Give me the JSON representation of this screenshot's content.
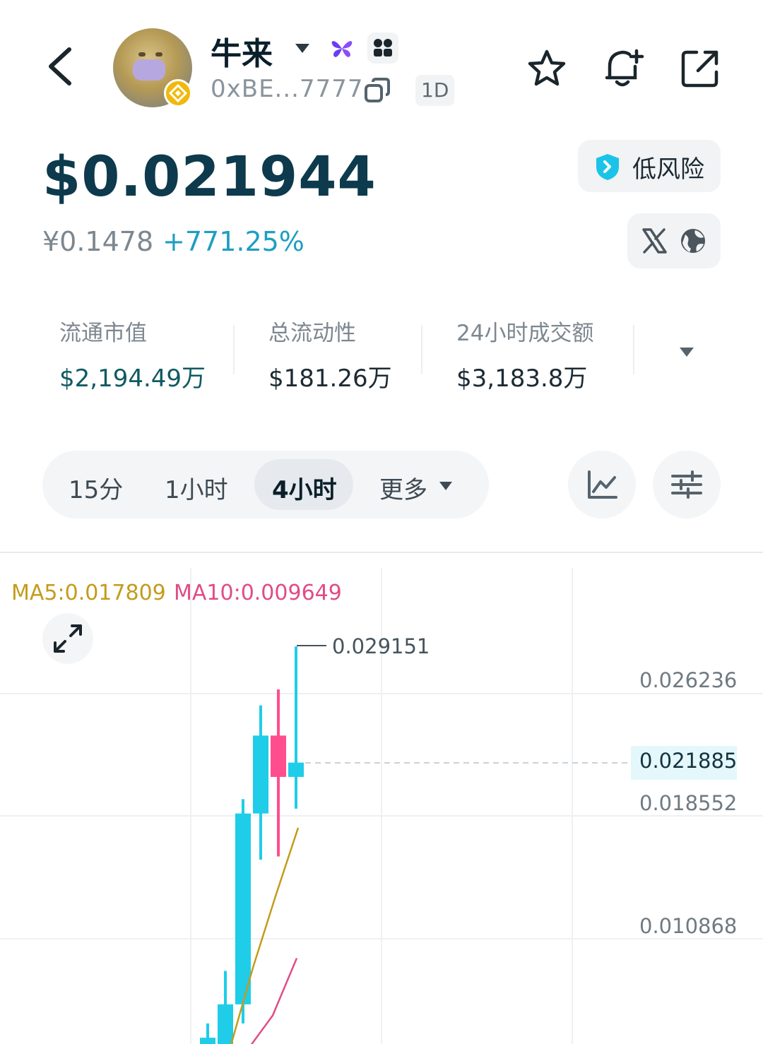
{
  "header": {
    "token_name": "牛来",
    "address": "0xBE...7777",
    "period_badge": "1D"
  },
  "price": {
    "usd": "$0.021944",
    "cny": "¥0.1478",
    "change": "+771.25%"
  },
  "risk": {
    "label": "低风险"
  },
  "stats": [
    {
      "label": "流通市值",
      "value": "$2,194.49万"
    },
    {
      "label": "总流动性",
      "value": "$181.26万"
    },
    {
      "label": "24小时成交额",
      "value": "$3,183.8万"
    }
  ],
  "intervals": {
    "tabs": [
      "15分",
      "1小时",
      "4小时"
    ],
    "active": "4小时",
    "more": "更多"
  },
  "chart": {
    "ma5": "MA5:0.017809",
    "ma10": "MA10:0.009649",
    "high_marker": "0.029151",
    "current_price": "0.021885",
    "y_labels": [
      "0.026236",
      "0.018552",
      "0.010868"
    ]
  },
  "colors": {
    "up": "#1fcde8",
    "down": "#ff4d8d",
    "ma5": "#c49b1c",
    "ma10": "#e04c86",
    "price": "#0d3a4c",
    "change": "#1e9fc0"
  },
  "chart_data": {
    "type": "candlestick",
    "series": [
      {
        "name": "MA5",
        "line": "ma5"
      },
      {
        "name": "MA10",
        "line": "ma10"
      }
    ],
    "candles": [
      {
        "open": 0.0036,
        "close": 0.0046,
        "high": 0.0055,
        "low": 0.0036,
        "dir": "up"
      },
      {
        "open": 0.004,
        "close": 0.0067,
        "high": 0.0088,
        "low": 0.0036,
        "dir": "up"
      },
      {
        "open": 0.0067,
        "close": 0.0187,
        "high": 0.0196,
        "low": 0.0055,
        "dir": "up"
      },
      {
        "open": 0.0187,
        "close": 0.0236,
        "high": 0.0255,
        "low": 0.0158,
        "dir": "up"
      },
      {
        "open": 0.0236,
        "close": 0.021,
        "high": 0.0265,
        "low": 0.016,
        "dir": "down"
      },
      {
        "open": 0.021,
        "close": 0.0219,
        "high": 0.0292,
        "low": 0.019,
        "dir": "up"
      }
    ],
    "ma5_points": [
      0.004,
      0.009,
      0.0135,
      0.0178
    ],
    "ma10_points": [
      0.0036,
      0.006,
      0.0096
    ],
    "y_axis": {
      "ticks": [
        0.026236,
        0.021885,
        0.018552,
        0.010868
      ]
    }
  }
}
